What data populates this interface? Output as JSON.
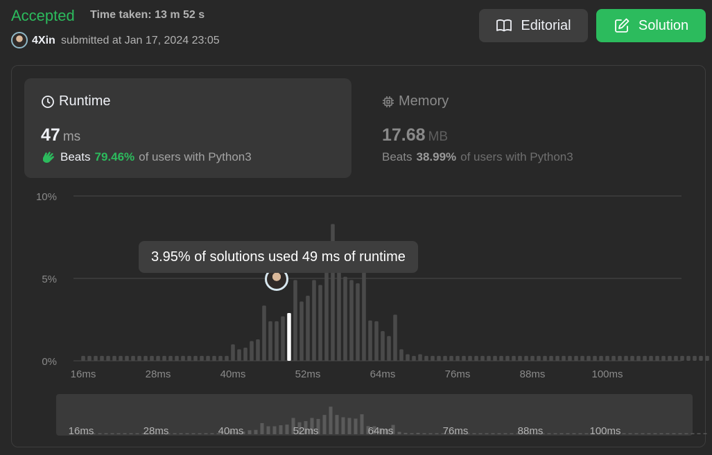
{
  "header": {
    "status": "Accepted",
    "time_taken": "Time taken: 13 m 52 s",
    "username": "4Xin",
    "submitted_text": "submitted at Jan 17, 2024 23:05",
    "editorial_label": "Editorial",
    "solution_label": "Solution"
  },
  "runtime": {
    "title": "Runtime",
    "value": "47",
    "unit": "ms",
    "beats_label": "Beats",
    "beats_pct": "79.46%",
    "beats_suffix": "of users with Python3",
    "icon": "clock-icon"
  },
  "memory": {
    "title": "Memory",
    "value": "17.68",
    "unit": "MB",
    "beats_label": "Beats",
    "beats_pct": "38.99%",
    "beats_suffix": "of users with Python3",
    "icon": "chip-icon"
  },
  "tooltip": "3.95% of solutions used 49 ms of runtime",
  "colors": {
    "accent": "#2cbb5d",
    "bar": "#4a4a4a",
    "highlight": "#ffffff",
    "background": "#282828"
  },
  "chart_data": {
    "type": "bar",
    "x": [
      16,
      17,
      18,
      19,
      20,
      21,
      22,
      23,
      24,
      25,
      26,
      27,
      28,
      29,
      30,
      31,
      32,
      33,
      34,
      35,
      36,
      37,
      38,
      39,
      40,
      41,
      42,
      43,
      44,
      45,
      46,
      47,
      48,
      49,
      50,
      51,
      52,
      53,
      54,
      55,
      56,
      57,
      58,
      59,
      60,
      61,
      62,
      63,
      64,
      65,
      66,
      67,
      68,
      69,
      70,
      71,
      72,
      73,
      74,
      75,
      76,
      77,
      78,
      79,
      80,
      81,
      82,
      83,
      84,
      85,
      86,
      87,
      88,
      89,
      90,
      91,
      92,
      93,
      94,
      95,
      96,
      97,
      98,
      99,
      100,
      101,
      102,
      103,
      104,
      105,
      106,
      107,
      108,
      109,
      110,
      111,
      112,
      113,
      114,
      115,
      116
    ],
    "values": [
      0.3,
      0.3,
      0.3,
      0.3,
      0.3,
      0.3,
      0.3,
      0.3,
      0.3,
      0.3,
      0.3,
      0.3,
      0.3,
      0.3,
      0.3,
      0.3,
      0.3,
      0.3,
      0.3,
      0.3,
      0.3,
      0.3,
      0.3,
      0.3,
      1.0,
      0.7,
      0.8,
      1.2,
      1.3,
      3.35,
      2.4,
      2.4,
      2.7,
      2.9,
      4.9,
      3.6,
      3.95,
      4.9,
      4.6,
      5.8,
      8.3,
      5.8,
      5.1,
      4.9,
      4.7,
      6.0,
      2.45,
      2.4,
      1.8,
      1.5,
      2.8,
      0.7,
      0.4,
      0.3,
      0.4,
      0.3,
      0.3,
      0.3,
      0.3,
      0.3,
      0.3,
      0.3,
      0.3,
      0.3,
      0.3,
      0.3,
      0.3,
      0.3,
      0.3,
      0.3,
      0.3,
      0.3,
      0.3,
      0.3,
      0.3,
      0.3,
      0.3,
      0.3,
      0.3,
      0.3,
      0.3,
      0.3,
      0.3,
      0.3,
      0.3,
      0.3,
      0.3,
      0.3,
      0.3,
      0.3,
      0.3,
      0.3,
      0.3,
      0.3,
      0.3,
      0.3,
      0.3,
      0.3,
      0.3,
      0.3,
      0.3
    ],
    "highlight_x": 49,
    "xlabel": "",
    "ylabel": "",
    "y_ticks": [
      "0%",
      "5%",
      "10%"
    ],
    "x_ticks": [
      "16ms",
      "28ms",
      "40ms",
      "52ms",
      "64ms",
      "76ms",
      "88ms",
      "100ms"
    ],
    "ylim": [
      0,
      10
    ],
    "grid": true
  }
}
